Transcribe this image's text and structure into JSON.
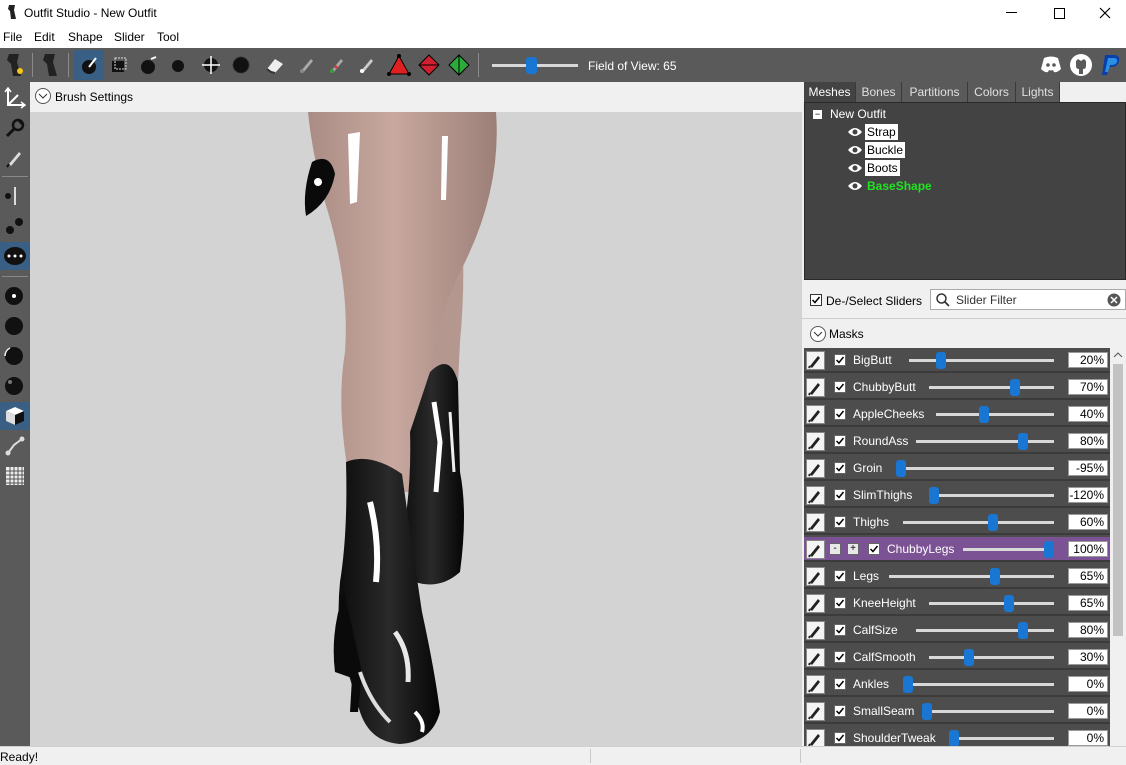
{
  "window": {
    "title": "Outfit Studio - New Outfit"
  },
  "menu": [
    "File",
    "Edit",
    "Shape",
    "Slider",
    "Tool"
  ],
  "toolbar": {
    "fov_label": "Field of View: 65",
    "fov_value": 65
  },
  "viewport": {
    "brush_settings_label": "Brush Settings"
  },
  "tabs": [
    "Meshes",
    "Bones",
    "Partitions",
    "Colors",
    "Lights"
  ],
  "tree": {
    "root": "New Outfit",
    "meshes": [
      {
        "label": "Strap"
      },
      {
        "label": "Buckle"
      },
      {
        "label": "Boots"
      },
      {
        "label": "BaseShape"
      }
    ]
  },
  "sliders_header": {
    "deselect_label": "De-/Select Sliders",
    "filter_placeholder": "Slider Filter",
    "masks_label": "Masks"
  },
  "sliders": [
    {
      "name": "BigButt",
      "value": "20%",
      "fraction": 0.2
    },
    {
      "name": "ChubbyButt",
      "value": "70%",
      "fraction": 0.7
    },
    {
      "name": "AppleCheeks",
      "value": "40%",
      "fraction": 0.4
    },
    {
      "name": "RoundAss",
      "value": "80%",
      "fraction": 0.8
    },
    {
      "name": "Groin",
      "value": "-95%",
      "fraction": 0.0
    },
    {
      "name": "SlimThighs",
      "value": "-120%",
      "fraction": 0.0
    },
    {
      "name": "Thighs",
      "value": "60%",
      "fraction": 0.6
    },
    {
      "name": "ChubbyLegs",
      "value": "100%",
      "fraction": 1.0,
      "active": true,
      "minus": "-",
      "plus": "+"
    },
    {
      "name": "Legs",
      "value": "65%",
      "fraction": 0.65
    },
    {
      "name": "KneeHeight",
      "value": "65%",
      "fraction": 0.65
    },
    {
      "name": "CalfSize",
      "value": "80%",
      "fraction": 0.8
    },
    {
      "name": "CalfSmooth",
      "value": "30%",
      "fraction": 0.3
    },
    {
      "name": "Ankles",
      "value": "0%",
      "fraction": 0.0
    },
    {
      "name": "SmallSeam",
      "value": "0%",
      "fraction": 0.0
    },
    {
      "name": "ShoulderTweak",
      "value": "0%",
      "fraction": 0.0
    }
  ],
  "status": {
    "text": "Ready!"
  }
}
